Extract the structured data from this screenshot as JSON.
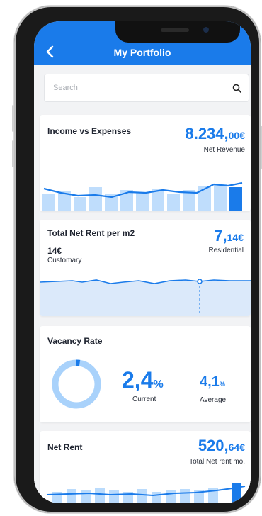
{
  "header": {
    "title": "My Portfolio"
  },
  "search": {
    "placeholder": "Search"
  },
  "income_card": {
    "title": "Income vs Expenses",
    "value_main": "8.234,",
    "value_decimal": "00€",
    "value_label": "Net Revenue"
  },
  "rent_m2_card": {
    "title": "Total Net Rent per m2",
    "value_main": "7,",
    "value_decimal": "14€",
    "value_label": "Residential",
    "customary_value": "14€",
    "customary_label": "Customary"
  },
  "vacancy_card": {
    "title": "Vacancy Rate",
    "current_main": "2,4",
    "current_unit": "%",
    "current_label": "Current",
    "average_main": "4,1",
    "average_unit": "%",
    "average_label": "Average",
    "donut_fraction": 0.024
  },
  "net_rent_card": {
    "title": "Net Rent",
    "value_main": "520,",
    "value_decimal": "64€",
    "value_label": "Total Net rent mo."
  },
  "colors": {
    "brand_blue": "#1a7bea",
    "light_blue": "#a9d2fb",
    "area_blue": "#dbe9fa"
  }
}
